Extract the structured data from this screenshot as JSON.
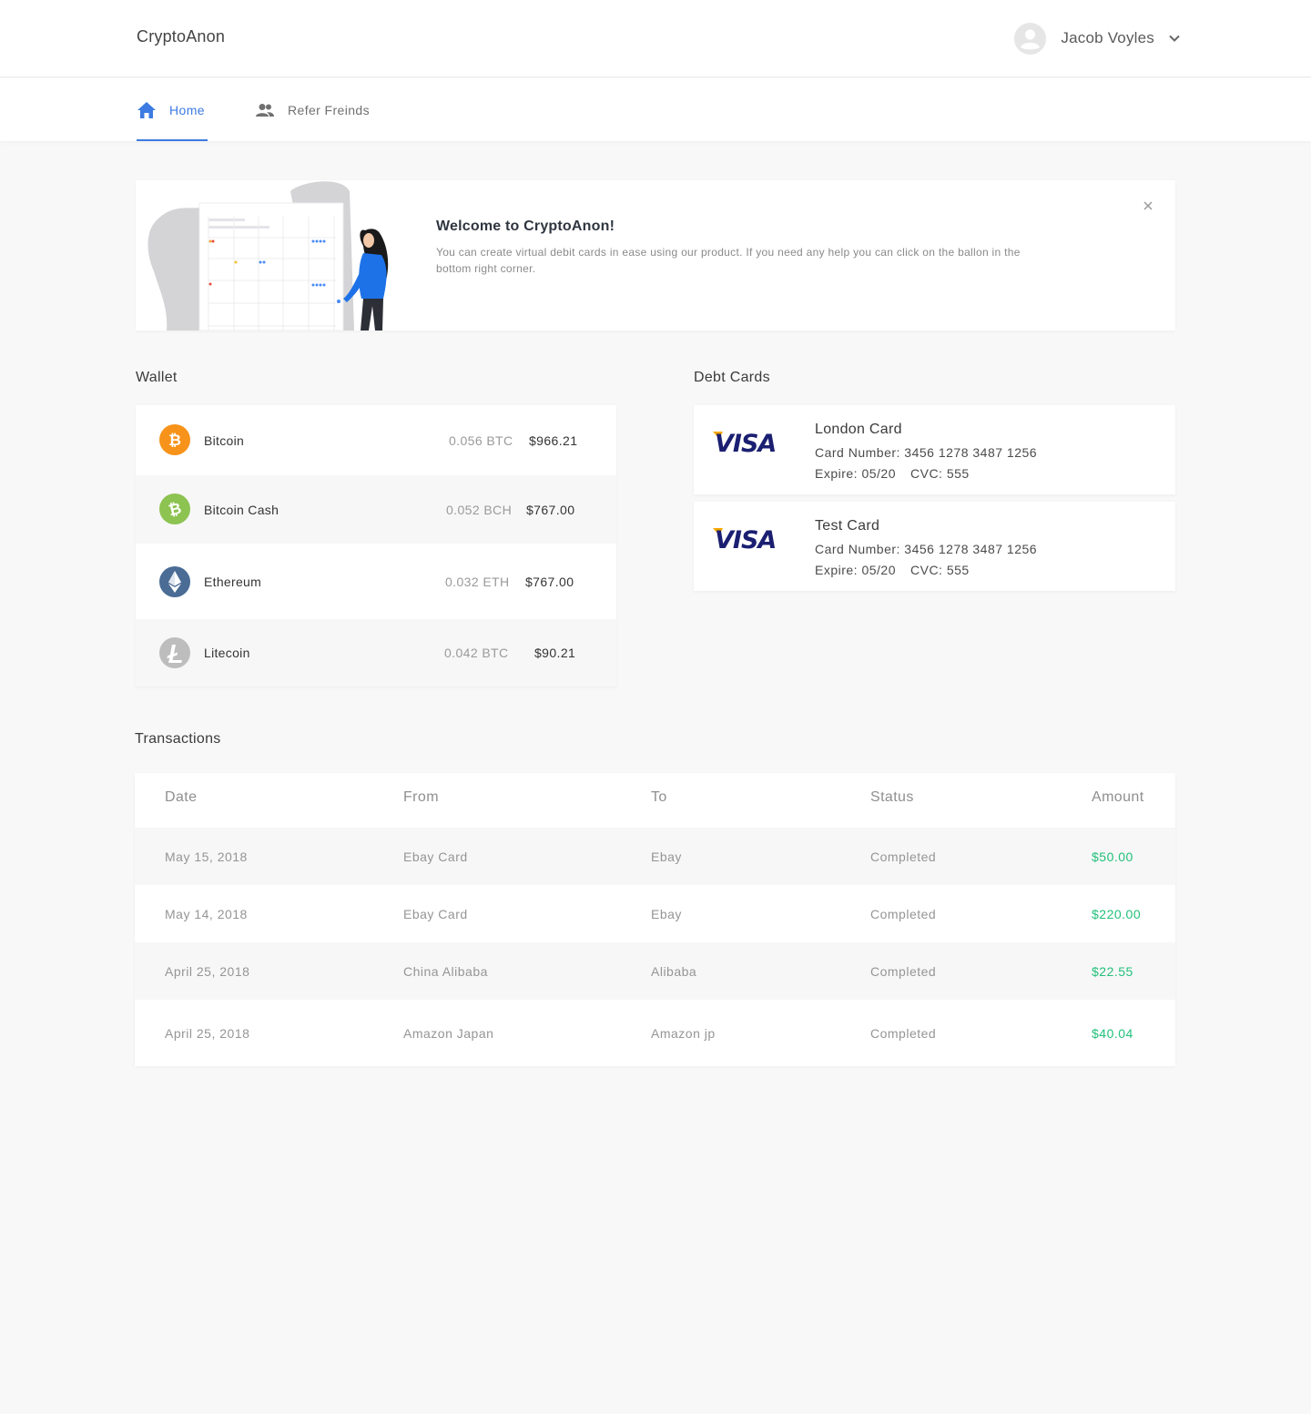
{
  "header": {
    "brand": "CryptoAnon",
    "user_name": "Jacob Voyles"
  },
  "nav": {
    "home": "Home",
    "refer": "Refer Freinds"
  },
  "welcome": {
    "title": "Welcome to CryptoAnon!",
    "text": "You can create virtual debit cards in ease using our product. If you need any help you can click on the ballon in the bottom right corner."
  },
  "wallet": {
    "title": "Wallet",
    "items": [
      {
        "name": "Bitcoin",
        "amount": "0.056 BTC",
        "usd": "$966.21",
        "icon": "bitcoin-icon",
        "color": "#f7931a"
      },
      {
        "name": "Bitcoin Cash",
        "amount": "0.052 BCH",
        "usd": "$767.00",
        "icon": "bitcoin-cash-icon",
        "color": "#8dc351"
      },
      {
        "name": "Ethereum",
        "amount": "0.032 ETH",
        "usd": "$767.00",
        "icon": "ethereum-icon",
        "color": "#4a6c95"
      },
      {
        "name": "Litecoin",
        "amount": "0.042 BTC",
        "usd": "$90.21",
        "icon": "litecoin-icon",
        "color": "#bdbdbd"
      }
    ]
  },
  "cards": {
    "title": "Debt Cards",
    "items": [
      {
        "name": "London Card",
        "number": "Card Number: 3456 1278 3487 1256",
        "expire": "Expire: 05/20",
        "cvc": "CVC: 555"
      },
      {
        "name": "Test Card",
        "number": "Card Number: 3456 1278 3487 1256",
        "expire": "Expire: 05/20",
        "cvc": "CVC: 555"
      }
    ]
  },
  "transactions": {
    "title": "Transactions",
    "headers": {
      "date": "Date",
      "from": "From",
      "to": "To",
      "status": "Status",
      "amount": "Amount"
    },
    "rows": [
      {
        "date": "May 15, 2018",
        "from": "Ebay Card",
        "to": "Ebay",
        "status": "Completed",
        "amount": "$50.00"
      },
      {
        "date": "May 14, 2018",
        "from": "Ebay Card",
        "to": "Ebay",
        "status": "Completed",
        "amount": "$220.00"
      },
      {
        "date": "April 25, 2018",
        "from": "China Alibaba",
        "to": "Alibaba",
        "status": "Completed",
        "amount": "$22.55"
      },
      {
        "date": "April 25, 2018",
        "from": "Amazon Japan",
        "to": "Amazon jp",
        "status": "Completed",
        "amount": "$40.04"
      }
    ]
  },
  "colors": {
    "accent": "#3d7be2",
    "positive": "#22c07a",
    "visa_blue": "#1a1f71",
    "visa_gold": "#f7a800"
  }
}
